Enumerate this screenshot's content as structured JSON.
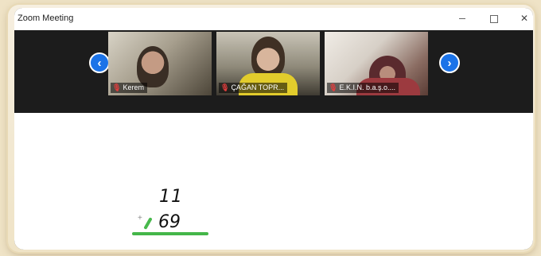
{
  "window": {
    "title": "Zoom Meeting",
    "controls": {
      "minimize": "minimize",
      "maximize": "maximize",
      "close": "✕"
    }
  },
  "gallery": {
    "prev_label": "‹",
    "next_label": "›",
    "participants": [
      {
        "name": "Kerem",
        "mic": "muted"
      },
      {
        "name": "ÇAĞAN TOPR...",
        "mic": "muted"
      },
      {
        "name": "E.K.I.N. b.a.ş.o....",
        "mic": "muted"
      }
    ]
  },
  "whiteboard": {
    "line1": "11",
    "line2": "69",
    "operator": "+"
  },
  "colors": {
    "accent": "#1b73e8",
    "muted_mic": "#e23d3d",
    "annotation_green": "#44b649"
  }
}
